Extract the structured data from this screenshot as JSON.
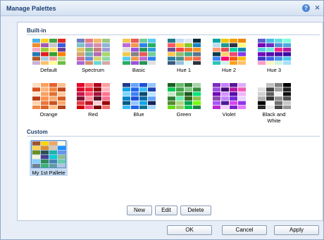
{
  "window": {
    "title": "Manage Palettes"
  },
  "sections": {
    "builtin": "Built-in",
    "custom": "Custom"
  },
  "builtin": [
    {
      "label": "Default",
      "colors": [
        "#4ab1e7",
        "#ffd21f",
        "#42a143",
        "#e52822",
        "#f28a2a",
        "#a159b4",
        "#c8c8c8",
        "#3b5bdb",
        "#f7a8c7",
        "#9acd32",
        "#ffde6a",
        "#6a3d9a",
        "#1f78b4",
        "#e31a1c",
        "#33a02c",
        "#ff7f00",
        "#b15928",
        "#a6cee3",
        "#fb9a99",
        "#b2df8a",
        "#cab2d6",
        "#fdbf6f",
        "#ffff99",
        "#6dbd45"
      ]
    },
    {
      "label": "Spectrum",
      "colors": [
        "#6c7fbf",
        "#e87c7c",
        "#f2b86a",
        "#9bc97d",
        "#7dc1c9",
        "#b38bd1",
        "#d98fa8",
        "#8fb3d9",
        "#e0c36a",
        "#7ab87a",
        "#c97d7d",
        "#9e9ed6",
        "#d6a36a",
        "#6ab3b3",
        "#b36ab3",
        "#a8d66a",
        "#d66a8f",
        "#6a8fd6",
        "#d6d66a",
        "#8fd6a8",
        "#a86ad6",
        "#d68f6a",
        "#6ad6d6",
        "#d6a8a8"
      ]
    },
    {
      "label": "Basic",
      "colors": [
        "#f2c94c",
        "#eb5757",
        "#6fcf97",
        "#56ccf2",
        "#bb6bd9",
        "#f2994a",
        "#2f80ed",
        "#27ae60",
        "#e0e0e0",
        "#9b51e0",
        "#219653",
        "#2d9cdb",
        "#f2c94c",
        "#828282",
        "#eb5757",
        "#6fcf97",
        "#56ccf2",
        "#f2994a",
        "#bb6bd9",
        "#2f80ed",
        "#27ae60",
        "#9b51e0",
        "#219653",
        "#e0e0e0"
      ]
    },
    {
      "label": "Hue 1",
      "colors": [
        "#1f7a8c",
        "#bfdbf7",
        "#e1e5f2",
        "#022b3a",
        "#ff595e",
        "#ffca3a",
        "#8ac926",
        "#1982c4",
        "#6a4c93",
        "#f94144",
        "#f3722c",
        "#f8961e",
        "#f9c74f",
        "#90be6d",
        "#43aa8b",
        "#577590",
        "#277da1",
        "#4d908e",
        "#f9844a",
        "#ee6c4d",
        "#3d5a80",
        "#98c1d9",
        "#e0fbfc",
        "#293241"
      ]
    },
    {
      "label": "Hue 2",
      "colors": [
        "#00a6a6",
        "#efca08",
        "#f49f0a",
        "#f08700",
        "#bbdef0",
        "#1b998b",
        "#2d3047",
        "#fffd82",
        "#ff9b71",
        "#e84855",
        "#06d6a0",
        "#118ab2",
        "#073b4c",
        "#ffd166",
        "#ef476f",
        "#8338ec",
        "#3a86ff",
        "#ff006e",
        "#fb5607",
        "#ffbe0b",
        "#2ec4b6",
        "#cbf3f0",
        "#ff9f1c",
        "#ffbf69"
      ]
    },
    {
      "label": "Hue 3",
      "colors": [
        "#5e60ce",
        "#48bfe3",
        "#64dfdf",
        "#80ffdb",
        "#7400b8",
        "#6930c3",
        "#5390d9",
        "#4ea8de",
        "#56cfe1",
        "#72efdd",
        "#f72585",
        "#b5179e",
        "#7209b7",
        "#560bad",
        "#480ca8",
        "#3a0ca3",
        "#3f37c9",
        "#4361ee",
        "#4895ef",
        "#4cc9f0",
        "#ff99c8",
        "#fcf6bd",
        "#d0f4de",
        "#a9def9"
      ]
    },
    {
      "label": "Orange",
      "colors": [
        "#ffddbe",
        "#ff9f5a",
        "#e8602c",
        "#fcbf8a",
        "#d9501f",
        "#ffb37a",
        "#f0873c",
        "#c2461a",
        "#ffe6cf",
        "#f7a163",
        "#e36f2e",
        "#ffc89a",
        "#b83d12",
        "#ff914d",
        "#f5ad72",
        "#d45a20",
        "#ffd3ad",
        "#e8773a",
        "#c95320",
        "#ffa86b",
        "#f28a45",
        "#dd6428",
        "#ffbf85",
        "#b0461a"
      ]
    },
    {
      "label": "Red",
      "colors": [
        "#e4002b",
        "#ff6b6b",
        "#b30021",
        "#ff9e9e",
        "#d90429",
        "#ef233c",
        "#8d0801",
        "#ffb3c1",
        "#c9184a",
        "#ff4d6d",
        "#a4133c",
        "#ff758f",
        "#800f2f",
        "#ff8fa3",
        "#590d22",
        "#fb6f92",
        "#e63946",
        "#c1121f",
        "#ffccd5",
        "#9d0208",
        "#d00000",
        "#ff5c8a",
        "#780000",
        "#f07167"
      ]
    },
    {
      "label": "Blue",
      "colors": [
        "#1e3a8a",
        "#60a5fa",
        "#1d4ed8",
        "#93c5fd",
        "#0ea5e9",
        "#2563eb",
        "#38bdf8",
        "#1e40af",
        "#7dd3fc",
        "#3b82f6",
        "#0c4a6e",
        "#bae6fd",
        "#0284c7",
        "#1d4ed8",
        "#0369a1",
        "#60a5fa",
        "#075985",
        "#93c5fd",
        "#0ea5e9",
        "#172554",
        "#38bdf8",
        "#2563eb",
        "#0e7490",
        "#a5d8ff"
      ]
    },
    {
      "label": "Green",
      "colors": [
        "#1b5e20",
        "#66bb6a",
        "#2e7d32",
        "#a5d6a7",
        "#00c853",
        "#43a047",
        "#81c784",
        "#388e3c",
        "#c8e6c9",
        "#4caf50",
        "#1b5e20",
        "#00e676",
        "#2e7d32",
        "#69f0ae",
        "#33691e",
        "#8bc34a",
        "#558b2f",
        "#aed581",
        "#00a152",
        "#76ff03",
        "#64dd17",
        "#9ccc65",
        "#00c853",
        "#1e8449"
      ]
    },
    {
      "label": "Violet",
      "colors": [
        "#7b2cbf",
        "#c77dff",
        "#5a189a",
        "#e0aaff",
        "#9d4edd",
        "#3c096c",
        "#b5179e",
        "#f15bb5",
        "#7209b7",
        "#d291ff",
        "#560bad",
        "#f0b3ff",
        "#8e44ad",
        "#c084fc",
        "#6d28d9",
        "#e9d5ff",
        "#a855f7",
        "#4c1d95",
        "#d946ef",
        "#9333ea",
        "#c026d3",
        "#f5d0fe",
        "#7e22ce",
        "#e879f9"
      ]
    },
    {
      "label": "Black and White",
      "colors": [
        "#ffffff",
        "#c0c0c0",
        "#808080",
        "#000000",
        "#e0e0e0",
        "#404040",
        "#a0a0a0",
        "#202020",
        "#d0d0d0",
        "#606060",
        "#f0f0f0",
        "#101010",
        "#b0b0b0",
        "#303030",
        "#909090",
        "#505050",
        "#000000",
        "#ffffff",
        "#707070",
        "#c8c8c8",
        "#282828",
        "#e8e8e8",
        "#484848",
        "#989898"
      ]
    }
  ],
  "custom": [
    {
      "label": "My 1st Pallete",
      "colors": [
        "#a0522d",
        "#ffd700",
        "#f4a460",
        "#ffffe0",
        "#ffd24d",
        "#e08a2e",
        "#d9c9b0",
        "#1e90ff",
        "#6b8e23",
        "#2f4f4f",
        "#20b2aa",
        "#6495ed",
        "#f5f5dc",
        "#483d8b",
        "#00ced1",
        "#8fbc8f",
        "#87cefa",
        "#2e8b57",
        "#4682b4",
        "#66cdaa",
        "#708090",
        "#3cb371",
        "#5f9ea0",
        "#b0c4de"
      ]
    }
  ],
  "buttons": {
    "new": "New",
    "edit": "Edit",
    "delete": "Delete",
    "ok": "OK",
    "cancel": "Cancel",
    "apply": "Apply"
  },
  "icons": {
    "help": "help-icon",
    "close": "close-icon"
  }
}
